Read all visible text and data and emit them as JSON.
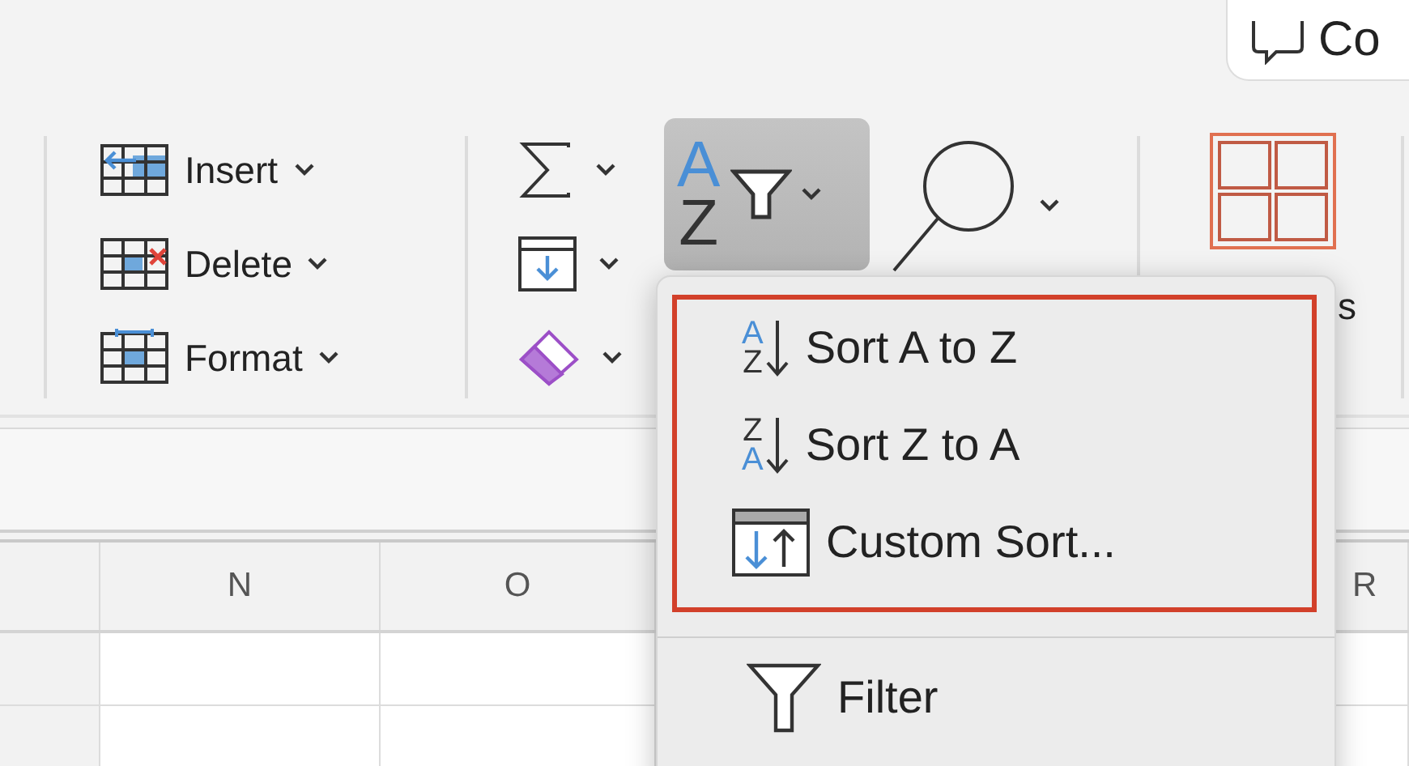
{
  "comments_button": {
    "label": "Co"
  },
  "cells_group": [
    {
      "kind": "insert",
      "label": "Insert"
    },
    {
      "kind": "delete",
      "label": "Delete"
    },
    {
      "kind": "format",
      "label": "Format"
    }
  ],
  "editing_group": [
    {
      "kind": "autosum"
    },
    {
      "kind": "fill"
    },
    {
      "kind": "clear"
    }
  ],
  "sort_filter_button": {
    "top_letter": "A",
    "bottom_letter": "Z",
    "selected": true
  },
  "hidden_label_fragment": "s",
  "columns": [
    {
      "label": "N"
    },
    {
      "label": "O"
    },
    {
      "label": "R"
    }
  ],
  "menu": {
    "boxed_items": [
      {
        "kind": "sort",
        "top_letter": "A",
        "bottom_letter": "Z",
        "top_blue": true,
        "label": "Sort A to Z"
      },
      {
        "kind": "sort",
        "top_letter": "Z",
        "bottom_letter": "A",
        "top_blue": false,
        "label": "Sort Z to A"
      },
      {
        "kind": "custom",
        "label": "Custom Sort..."
      }
    ],
    "items": [
      {
        "kind": "filter",
        "label": "Filter"
      }
    ]
  }
}
